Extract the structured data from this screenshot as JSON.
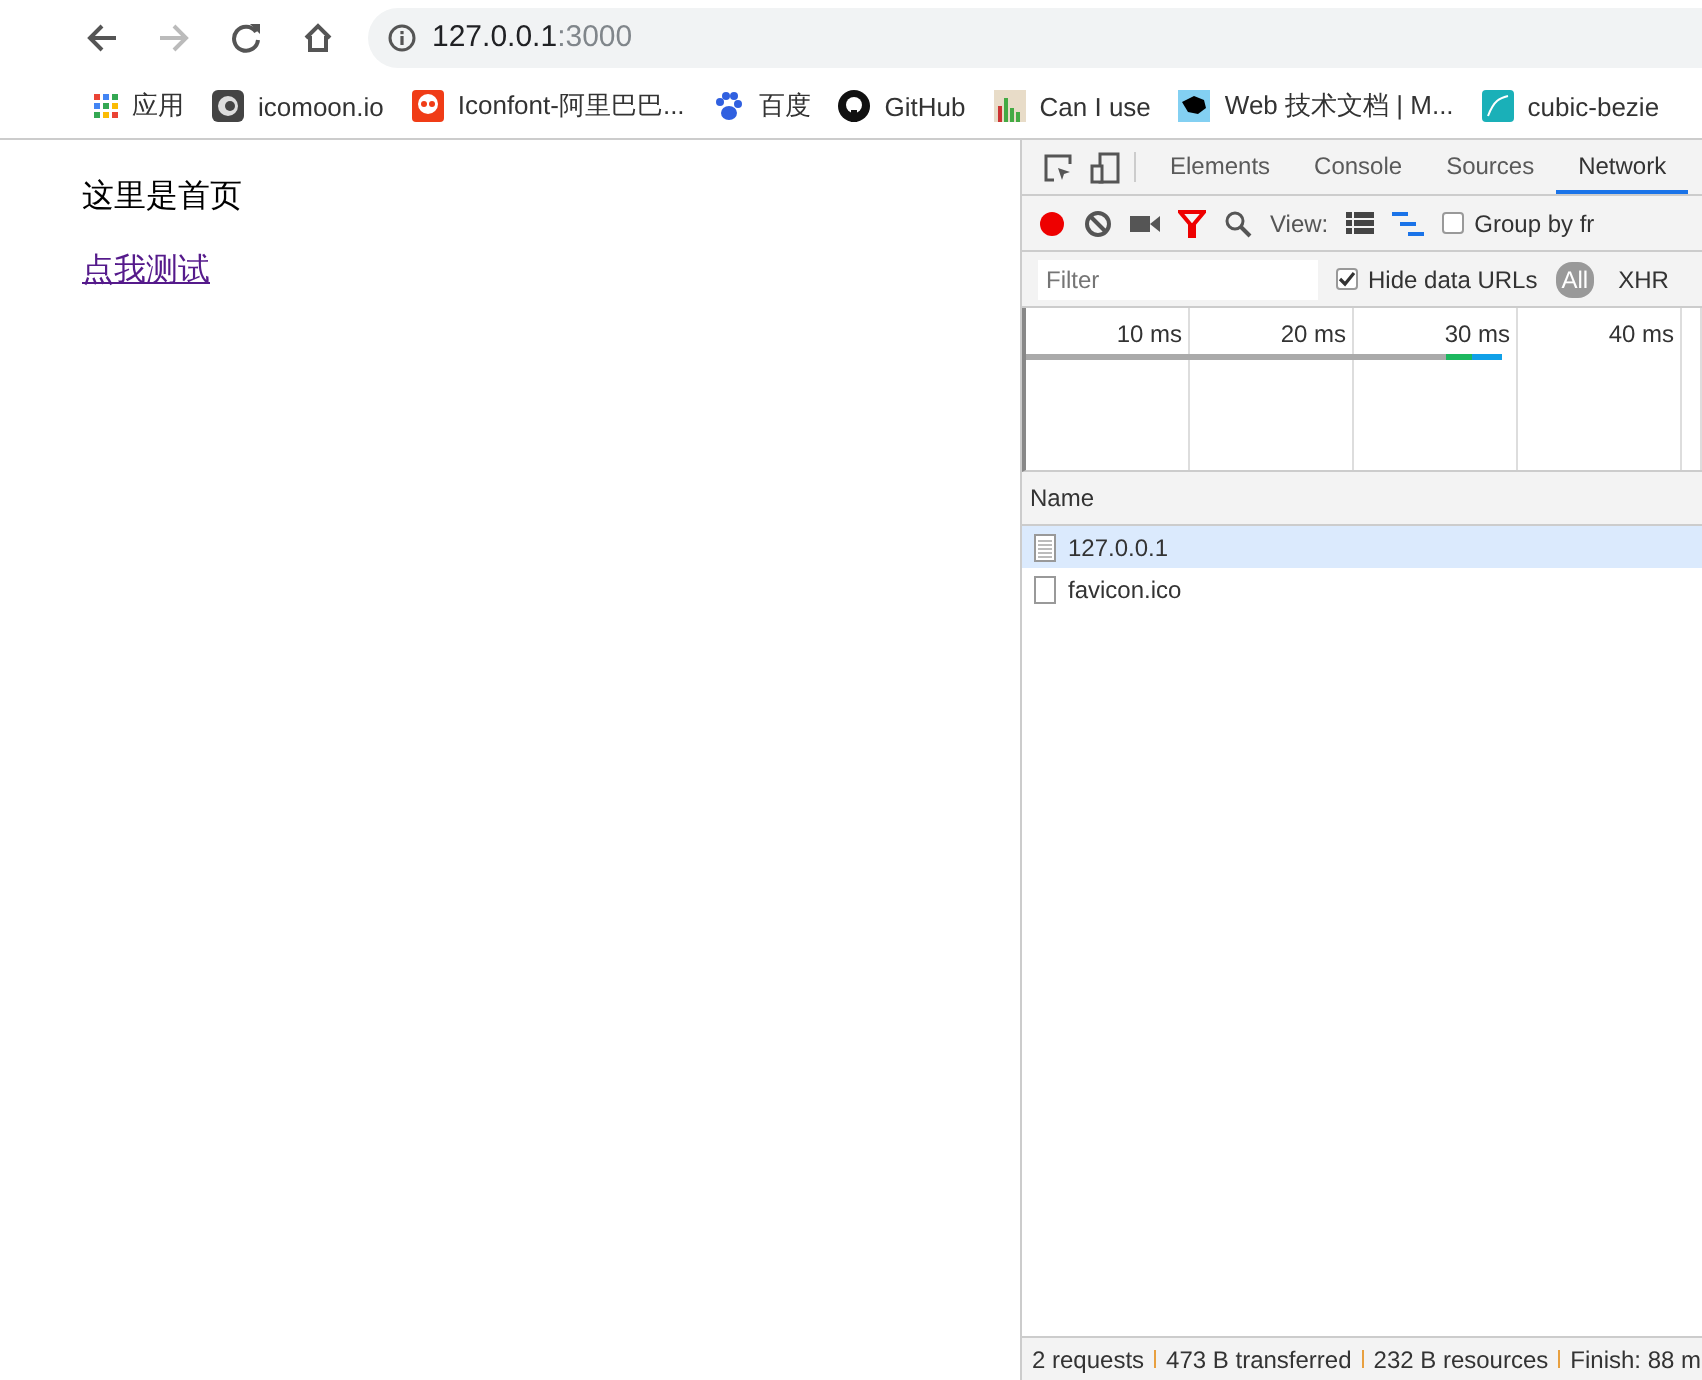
{
  "address_bar": {
    "host": "127.0.0.1",
    "port": ":3000"
  },
  "bookmarks": [
    {
      "label": "应用",
      "kind": "apps"
    },
    {
      "label": "icomoon.io",
      "kind": "icomoon"
    },
    {
      "label": "Iconfont-阿里巴巴...",
      "kind": "iconfont"
    },
    {
      "label": "百度",
      "kind": "paw"
    },
    {
      "label": "GitHub",
      "kind": "github"
    },
    {
      "label": "Can I use",
      "kind": "chart"
    },
    {
      "label": "Web 技术文档 | M...",
      "kind": "dino"
    },
    {
      "label": "cubic-bezie",
      "kind": "curve"
    }
  ],
  "page": {
    "heading": "这里是首页",
    "link": "点我测试"
  },
  "devtools": {
    "tabs": [
      {
        "label": "Elements",
        "selected": false
      },
      {
        "label": "Console",
        "selected": false
      },
      {
        "label": "Sources",
        "selected": false
      },
      {
        "label": "Network",
        "selected": true
      }
    ],
    "toolbar": {
      "view_label": "View:",
      "group_by": {
        "label": "Group by fr",
        "checked": false
      }
    },
    "filter": {
      "placeholder": "Filter",
      "hide_data_urls": {
        "label": "Hide data URLs",
        "checked": true
      },
      "types": [
        {
          "label": "All",
          "selected": true
        },
        {
          "label": "XHR",
          "selected": false
        }
      ]
    },
    "timeline_ticks": [
      "10 ms",
      "20 ms",
      "30 ms",
      "40 ms"
    ],
    "table": {
      "column": "Name",
      "rows": [
        {
          "name": "127.0.0.1",
          "kind": "document",
          "selected": true
        },
        {
          "name": "favicon.ico",
          "kind": "blank",
          "selected": false
        }
      ]
    },
    "status_bar": [
      "2 requests",
      "473 B transferred",
      "232 B resources",
      "Finish: 88 m"
    ]
  }
}
